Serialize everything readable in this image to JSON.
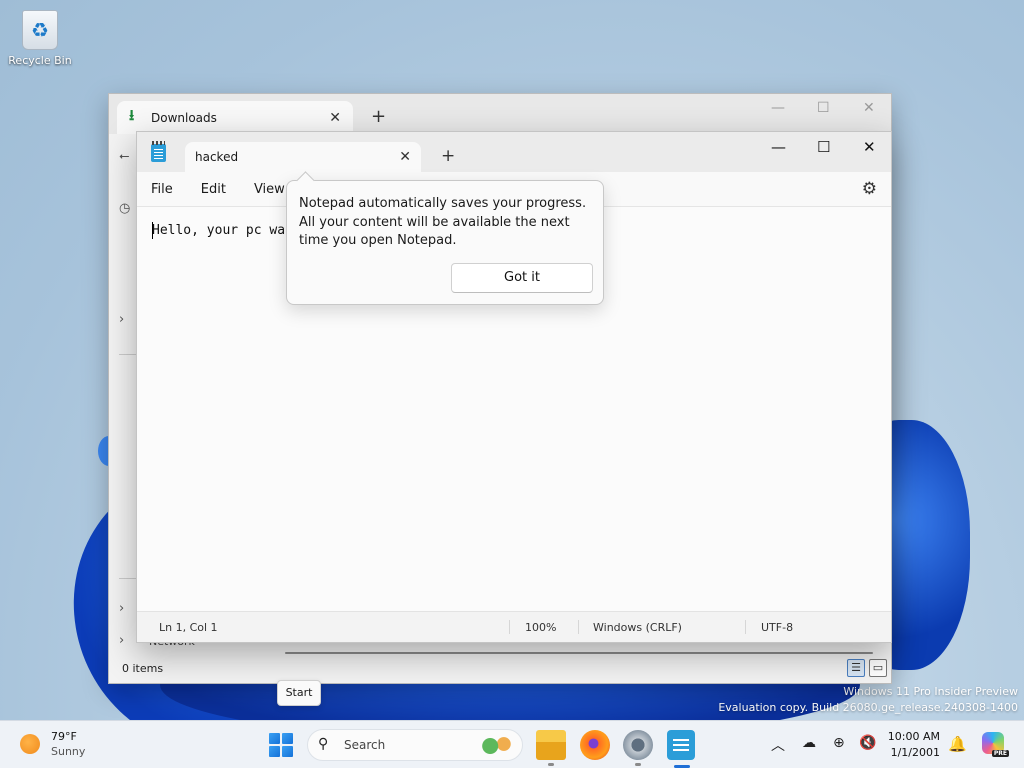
{
  "desktop": {
    "recycle_bin_label": "Recycle Bin",
    "watermark_line1": "Windows 11 Pro Insider Preview",
    "watermark_line2": "Evaluation copy. Build 26080.ge_release.240308-1400"
  },
  "explorer": {
    "tab_title": "Downloads",
    "tab_close": "✕",
    "new_tab": "+",
    "status_items": "0 items",
    "network_label": "Network",
    "icons": [
      "download-icon",
      "chevron-right-icon",
      "details-view-icon",
      "tiles-view-icon"
    ]
  },
  "notepad": {
    "tab_title": "hacked",
    "tab_close": "✕",
    "new_tab": "+",
    "menu": [
      "File",
      "Edit",
      "View"
    ],
    "content": "Hello, your pc wa",
    "status": {
      "position": "Ln 1, Col 1",
      "zoom": "100%",
      "line_ending": "Windows (CRLF)",
      "encoding": "UTF-8"
    },
    "window_controls": {
      "minimize": "—",
      "maximize": "☐",
      "close": "✕"
    },
    "icons": [
      "notepad-icon",
      "gear-icon"
    ]
  },
  "teaching_tip": {
    "message": "Notepad automatically saves your progress. All your content will be available the next time you open Notepad.",
    "button": "Got it"
  },
  "start_tooltip": "Start",
  "taskbar": {
    "weather_temp": "79°F",
    "weather_condition": "Sunny",
    "search_label": "Search",
    "clock_time": "10:00 AM",
    "clock_date": "1/1/2001",
    "apps": [
      "file-explorer-icon",
      "firefox-icon",
      "settings-icon",
      "notepad-icon"
    ],
    "tray_icons": [
      "chevron-up-icon",
      "network-icon",
      "globe-icon",
      "volume-muted-icon",
      "bell-icon",
      "copilot-icon"
    ],
    "copilot_badge": "PRE",
    "accent": "#1f6fd6"
  }
}
